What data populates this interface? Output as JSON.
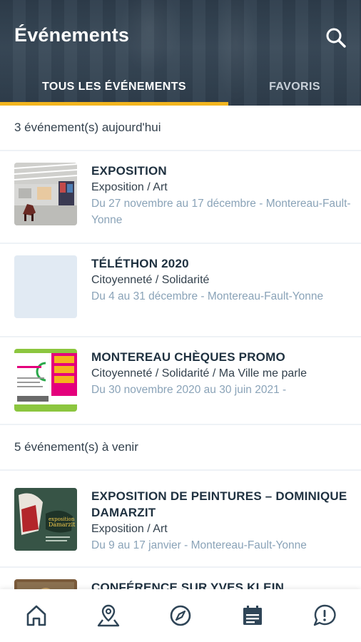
{
  "header": {
    "title": "Événements",
    "search_icon": "search-icon"
  },
  "tabs": [
    {
      "label": "TOUS LES ÉVÉNEMENTS",
      "active": true
    },
    {
      "label": "FAVORIS",
      "active": false
    }
  ],
  "accent_color": "#f2b51e",
  "sections": {
    "today": {
      "header": "3 événement(s) aujourd'hui",
      "events": [
        {
          "title": "EXPOSITION",
          "category": "Exposition / Art",
          "dates": "Du 27 novembre au 17 décembre - Montereau-Fault-Yonne"
        },
        {
          "title": "TÉLÉTHON 2020",
          "category": "Citoyenneté / Solidarité",
          "dates": "Du 4 au 31 décembre - Montereau-Fault-Yonne"
        },
        {
          "title": "MONTEREAU CHÈQUES PROMO",
          "category": "Citoyenneté / Solidarité / Ma Ville me parle",
          "dates": "Du 30 novembre 2020 au 30 juin 2021 -"
        }
      ]
    },
    "upcoming": {
      "header": "5 événement(s) à venir",
      "events": [
        {
          "title": "EXPOSITION DE PEINTURES – DOMINIQUE DAMARZIT",
          "category": "Exposition / Art",
          "dates": "Du 9 au 17 janvier - Montereau-Fault-Yonne"
        },
        {
          "title": "CONFÉRENCE SUR YVES KLEIN",
          "category": "",
          "dates": ""
        }
      ]
    }
  },
  "bottom_nav": [
    {
      "icon": "home-icon",
      "active": false
    },
    {
      "icon": "map-pin-icon",
      "active": false
    },
    {
      "icon": "compass-icon",
      "active": false
    },
    {
      "icon": "calendar-icon",
      "active": true
    },
    {
      "icon": "alert-bubble-icon",
      "active": false
    }
  ]
}
